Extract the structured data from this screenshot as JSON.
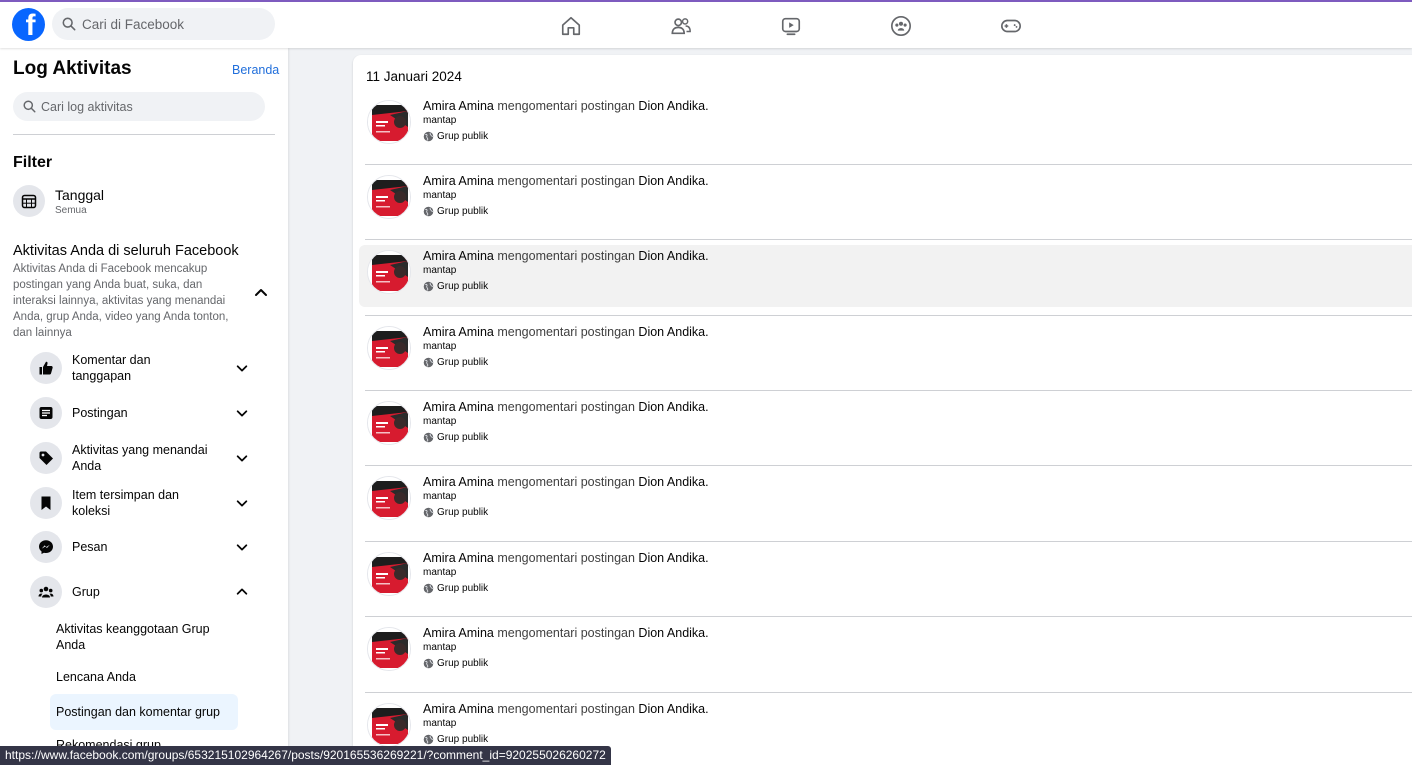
{
  "topbar": {
    "logo": "f",
    "search_placeholder": "Cari di Facebook",
    "nav": [
      "home-icon",
      "friends-icon",
      "video-icon",
      "groups-icon",
      "gaming-icon"
    ]
  },
  "sidebar": {
    "title": "Log Aktivitas",
    "home_link": "Beranda",
    "search_placeholder": "Cari log aktivitas",
    "filter_heading": "Filter",
    "date_filter": {
      "label": "Tanggal",
      "value": "Semua"
    },
    "activity_heading": "Aktivitas Anda di seluruh Facebook",
    "activity_desc": "Aktivitas Anda di Facebook mencakup postingan yang Anda buat, suka, dan interaksi lainnya, aktivitas yang menandai Anda, grup Anda, video yang Anda tonton, dan lainnya",
    "categories": [
      {
        "label": "Komentar dan tanggapan",
        "icon": "like-icon"
      },
      {
        "label": "Postingan",
        "icon": "post-icon"
      },
      {
        "label": "Aktivitas yang menandai Anda",
        "icon": "tag-icon"
      },
      {
        "label": "Item tersimpan dan koleksi",
        "icon": "bookmark-icon"
      },
      {
        "label": "Pesan",
        "icon": "messenger-icon"
      },
      {
        "label": "Grup",
        "icon": "group-icon"
      }
    ],
    "group_sub": [
      "Aktivitas keanggotaan Grup Anda",
      "Lencana Anda",
      "Postingan dan komentar grup",
      "Rekomendasi grup"
    ]
  },
  "main": {
    "date_heading": "11 Januari 2024",
    "items": [
      {
        "actor": "Amira Amina",
        "verb": "mengomentari postingan",
        "target": "Dion Andika",
        "comment": "mantap",
        "audience": "Grup publik"
      },
      {
        "actor": "Amira Amina",
        "verb": "mengomentari postingan",
        "target": "Dion Andika",
        "comment": "mantap",
        "audience": "Grup publik"
      },
      {
        "actor": "Amira Amina",
        "verb": "mengomentari postingan",
        "target": "Dion Andika",
        "comment": "mantap",
        "audience": "Grup publik"
      },
      {
        "actor": "Amira Amina",
        "verb": "mengomentari postingan",
        "target": "Dion Andika",
        "comment": "mantap",
        "audience": "Grup publik"
      },
      {
        "actor": "Amira Amina",
        "verb": "mengomentari postingan",
        "target": "Dion Andika",
        "comment": "mantap",
        "audience": "Grup publik"
      },
      {
        "actor": "Amira Amina",
        "verb": "mengomentari postingan",
        "target": "Dion Andika",
        "comment": "mantap",
        "audience": "Grup publik"
      },
      {
        "actor": "Amira Amina",
        "verb": "mengomentari postingan",
        "target": "Dion Andika",
        "comment": "mantap",
        "audience": "Grup publik"
      },
      {
        "actor": "Amira Amina",
        "verb": "mengomentari postingan",
        "target": "Dion Andika",
        "comment": "mantap",
        "audience": "Grup publik"
      },
      {
        "actor": "Amira Amina",
        "verb": "mengomentari postingan",
        "target": "Dion Andika",
        "comment": "mantap",
        "audience": "Grup publik"
      }
    ]
  },
  "status_url": "https://www.facebook.com/groups/653215102964267/posts/920165536269221/?comment_id=920255026260272",
  "colors": {
    "brand": "#0866ff",
    "link": "#216fdb",
    "active_bg": "#ebf5ff"
  }
}
